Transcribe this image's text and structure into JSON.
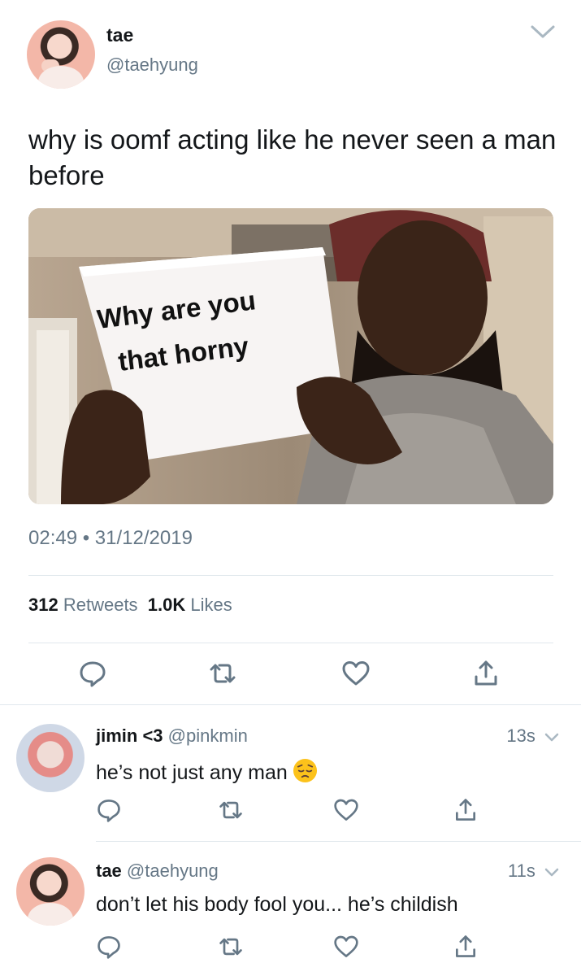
{
  "tweet": {
    "author_name": "tae",
    "author_handle": "@taehyung",
    "text": "why is oomf acting like he never seen a man before",
    "image_caption_line1": "Why are you",
    "image_caption_line2": "that horny",
    "timestamp": "02:49 • 31/12/2019",
    "retweets_count": "312",
    "retweets_label": "Retweets",
    "likes_count": "1.0K",
    "likes_label": "Likes"
  },
  "replies": [
    {
      "name": "jimin <3",
      "handle": "@pinkmin",
      "time": "13s",
      "text": "he’s not just any man",
      "emoji": "pensive-face"
    },
    {
      "name": "tae",
      "handle": "@taehyung",
      "time": "11s",
      "text": "don’t let his body fool you... he’s childish"
    }
  ],
  "icons": [
    "reply-icon",
    "retweet-icon",
    "like-icon",
    "share-icon",
    "chevron-down-icon"
  ],
  "colors": {
    "text_primary": "#14171a",
    "text_secondary": "#657786",
    "icon_gray": "#657786",
    "divider": "#e1e8ed"
  }
}
